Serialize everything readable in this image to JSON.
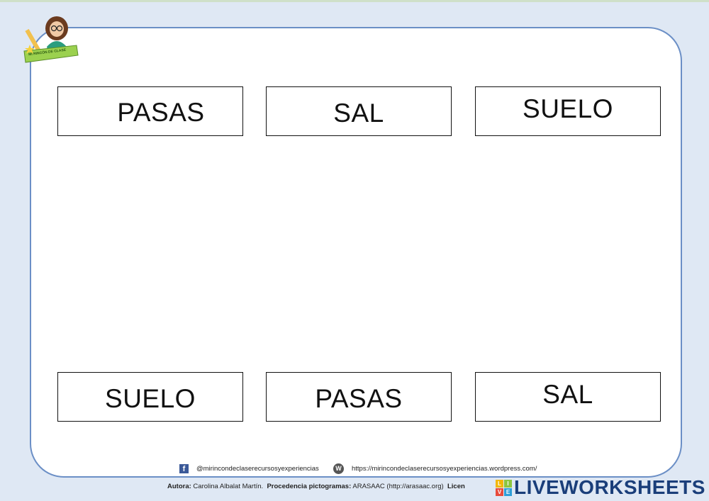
{
  "words": {
    "top": [
      "PASAS",
      "SAL",
      "SUELO"
    ],
    "bottom": [
      "SUELO",
      "PASAS",
      "SAL"
    ]
  },
  "logo": {
    "caption": "MI RINCÓN DE CLASE"
  },
  "footer": {
    "facebook": "@mirincondeclaserecursosyexperiencias",
    "website": "https://mirincondeclaserecursosyexperiencias.wordpress.com/",
    "author_label": "Autora:",
    "author_name": "Carolina Albalat Martín.",
    "pictos_label": "Procedencia pictogramas:",
    "pictos_value": "ARASAAC (http://arasaac.org)",
    "license_label": "Licen"
  },
  "brand": {
    "mini_letters": [
      "L",
      "I",
      "V",
      "E"
    ],
    "name": "LIVEWORKSHEETS",
    "colors": {
      "brand": "#1a3e7a",
      "mini": [
        "#f2b705",
        "#8cc63f",
        "#e84c3d",
        "#2e9fd8"
      ]
    }
  },
  "icons": {
    "facebook": "facebook-icon",
    "wordpress": "wordpress-icon"
  }
}
